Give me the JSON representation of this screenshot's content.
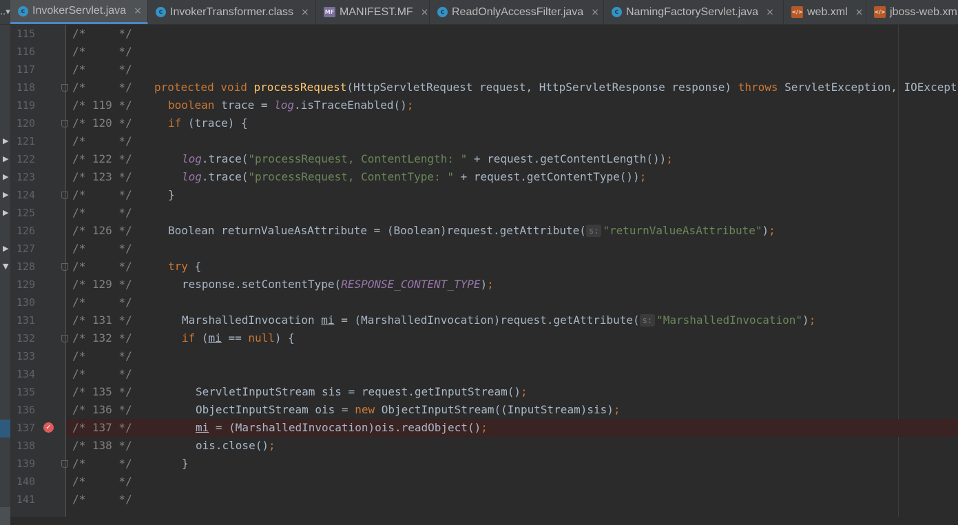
{
  "tabbar": {
    "lead": "..▾"
  },
  "tabs": [
    {
      "label": "InvokerServlet.java",
      "icon": "class-icon",
      "active": true
    },
    {
      "label": "InvokerTransformer.class",
      "icon": "class-icon",
      "active": false
    },
    {
      "label": "MANIFEST.MF",
      "icon": "manifest-icon",
      "active": false
    },
    {
      "label": "ReadOnlyAccessFilter.java",
      "icon": "class-icon",
      "active": false
    },
    {
      "label": "NamingFactoryServlet.java",
      "icon": "class-icon",
      "active": false
    },
    {
      "label": "web.xml",
      "icon": "xml-icon",
      "active": false
    },
    {
      "label": "jboss-web.xm",
      "icon": "xml-icon",
      "active": false
    }
  ],
  "icon_text": {
    "class": "c",
    "mf": "MF",
    "xml": "</>"
  },
  "tab_close": "×",
  "breakpoint_glyph": "✓",
  "colors": {
    "keyword": "#cc7832",
    "method": "#ffc66d",
    "string": "#6a8759",
    "field": "#9876aa",
    "text": "#a9b7c6",
    "breakpoint": "#db5c5c"
  },
  "lines": [
    {
      "n": "115",
      "comment": "/*     */",
      "indent": 0,
      "code": []
    },
    {
      "n": "116",
      "comment": "/*     */",
      "indent": 0,
      "code": []
    },
    {
      "n": "117",
      "comment": "/*     */",
      "indent": 0,
      "code": []
    },
    {
      "n": "118",
      "comment": "/*     */",
      "indent": 0,
      "fold": true,
      "code": [
        {
          "t": "protected void ",
          "c": "kw"
        },
        {
          "t": "processRequest",
          "c": "fn"
        },
        {
          "t": "(HttpServletRequest request, HttpServletResponse response) "
        },
        {
          "t": "throws ",
          "c": "kw"
        },
        {
          "t": "ServletException, IOException"
        }
      ]
    },
    {
      "n": "119",
      "comment": "/* 119 */",
      "indent": 1,
      "code": [
        {
          "t": "boolean ",
          "c": "kw"
        },
        {
          "t": "trace = "
        },
        {
          "t": "log",
          "c": "fld"
        },
        {
          "t": ".isTraceEnabled()"
        },
        {
          "t": ";",
          "c": "kw"
        }
      ]
    },
    {
      "n": "120",
      "comment": "/* 120 */",
      "indent": 1,
      "fold": true,
      "code": [
        {
          "t": "if ",
          "c": "kw"
        },
        {
          "t": "(trace) {"
        }
      ]
    },
    {
      "n": "121",
      "comment": "/*     */",
      "indent": 0,
      "code": []
    },
    {
      "n": "122",
      "comment": "/* 122 */",
      "indent": 2,
      "code": [
        {
          "t": "log",
          "c": "fld"
        },
        {
          "t": ".trace("
        },
        {
          "t": "\"processRequest, ContentLength: \"",
          "c": "str"
        },
        {
          "t": " + request.getContentLength())"
        },
        {
          "t": ";",
          "c": "kw"
        }
      ]
    },
    {
      "n": "123",
      "comment": "/* 123 */",
      "indent": 2,
      "code": [
        {
          "t": "log",
          "c": "fld"
        },
        {
          "t": ".trace("
        },
        {
          "t": "\"processRequest, ContentType: \"",
          "c": "str"
        },
        {
          "t": " + request.getContentType())"
        },
        {
          "t": ";",
          "c": "kw"
        }
      ]
    },
    {
      "n": "124",
      "comment": "/*     */",
      "indent": 1,
      "fold": true,
      "code": [
        {
          "t": "}"
        }
      ]
    },
    {
      "n": "125",
      "comment": "/*     */",
      "indent": 0,
      "code": []
    },
    {
      "n": "126",
      "comment": "/* 126 */",
      "indent": 1,
      "code": [
        {
          "t": "Boolean returnValueAsAttribute = (Boolean)request.getAttribute("
        },
        {
          "t": "s:",
          "c": "hint"
        },
        {
          "t": "\"returnValueAsAttribute\"",
          "c": "str"
        },
        {
          "t": ")"
        },
        {
          "t": ";",
          "c": "kw"
        }
      ]
    },
    {
      "n": "127",
      "comment": "/*     */",
      "indent": 0,
      "code": []
    },
    {
      "n": "128",
      "comment": "/*     */",
      "indent": 1,
      "fold": true,
      "code": [
        {
          "t": "try ",
          "c": "kw"
        },
        {
          "t": "{"
        }
      ]
    },
    {
      "n": "129",
      "comment": "/* 129 */",
      "indent": 2,
      "code": [
        {
          "t": "response.setContentType("
        },
        {
          "t": "RESPONSE_CONTENT_TYPE",
          "c": "fld"
        },
        {
          "t": ")"
        },
        {
          "t": ";",
          "c": "kw"
        }
      ]
    },
    {
      "n": "130",
      "comment": "/*     */",
      "indent": 0,
      "code": []
    },
    {
      "n": "131",
      "comment": "/* 131 */",
      "indent": 2,
      "code": [
        {
          "t": "MarshalledInvocation "
        },
        {
          "t": "mi",
          "c": "und"
        },
        {
          "t": " = (MarshalledInvocation)request.getAttribute("
        },
        {
          "t": "s:",
          "c": "hint"
        },
        {
          "t": "\"MarshalledInvocation\"",
          "c": "str"
        },
        {
          "t": ")"
        },
        {
          "t": ";",
          "c": "kw"
        }
      ]
    },
    {
      "n": "132",
      "comment": "/* 132 */",
      "indent": 2,
      "fold": true,
      "code": [
        {
          "t": "if ",
          "c": "kw"
        },
        {
          "t": "("
        },
        {
          "t": "mi",
          "c": "und"
        },
        {
          "t": " == "
        },
        {
          "t": "null",
          "c": "kw"
        },
        {
          "t": ") {"
        }
      ]
    },
    {
      "n": "133",
      "comment": "/*     */",
      "indent": 0,
      "code": []
    },
    {
      "n": "134",
      "comment": "/*     */",
      "indent": 0,
      "code": []
    },
    {
      "n": "135",
      "comment": "/* 135 */",
      "indent": 3,
      "code": [
        {
          "t": "ServletInputStream sis = request.getInputStream()"
        },
        {
          "t": ";",
          "c": "kw"
        }
      ]
    },
    {
      "n": "136",
      "comment": "/* 136 */",
      "indent": 3,
      "code": [
        {
          "t": "ObjectInputStream ois = "
        },
        {
          "t": "new ",
          "c": "kw"
        },
        {
          "t": "ObjectInputStream((InputStream)sis)"
        },
        {
          "t": ";",
          "c": "kw"
        }
      ]
    },
    {
      "n": "137",
      "comment": "/* 137 */",
      "indent": 3,
      "breakpoint": true,
      "code": [
        {
          "t": "mi",
          "c": "und"
        },
        {
          "t": " = (MarshalledInvocation)ois.readObject()"
        },
        {
          "t": ";",
          "c": "kw"
        }
      ]
    },
    {
      "n": "138",
      "comment": "/* 138 */",
      "indent": 3,
      "code": [
        {
          "t": "ois.close()"
        },
        {
          "t": ";",
          "c": "kw"
        }
      ]
    },
    {
      "n": "139",
      "comment": "/*     */",
      "indent": 2,
      "fold": true,
      "code": [
        {
          "t": "}"
        }
      ]
    },
    {
      "n": "140",
      "comment": "/*     */",
      "indent": 0,
      "code": []
    },
    {
      "n": "141",
      "comment": "/*     */",
      "indent": 0,
      "code": []
    }
  ],
  "structure_arrows": [
    {
      "line": "121",
      "glyph": "▶"
    },
    {
      "line": "122",
      "glyph": "▶"
    },
    {
      "line": "123",
      "glyph": "▶"
    },
    {
      "line": "124",
      "glyph": "▶"
    },
    {
      "line": "125",
      "glyph": "▶"
    },
    {
      "line": "127",
      "glyph": "▶"
    },
    {
      "line": "128",
      "glyph": "▼"
    }
  ]
}
